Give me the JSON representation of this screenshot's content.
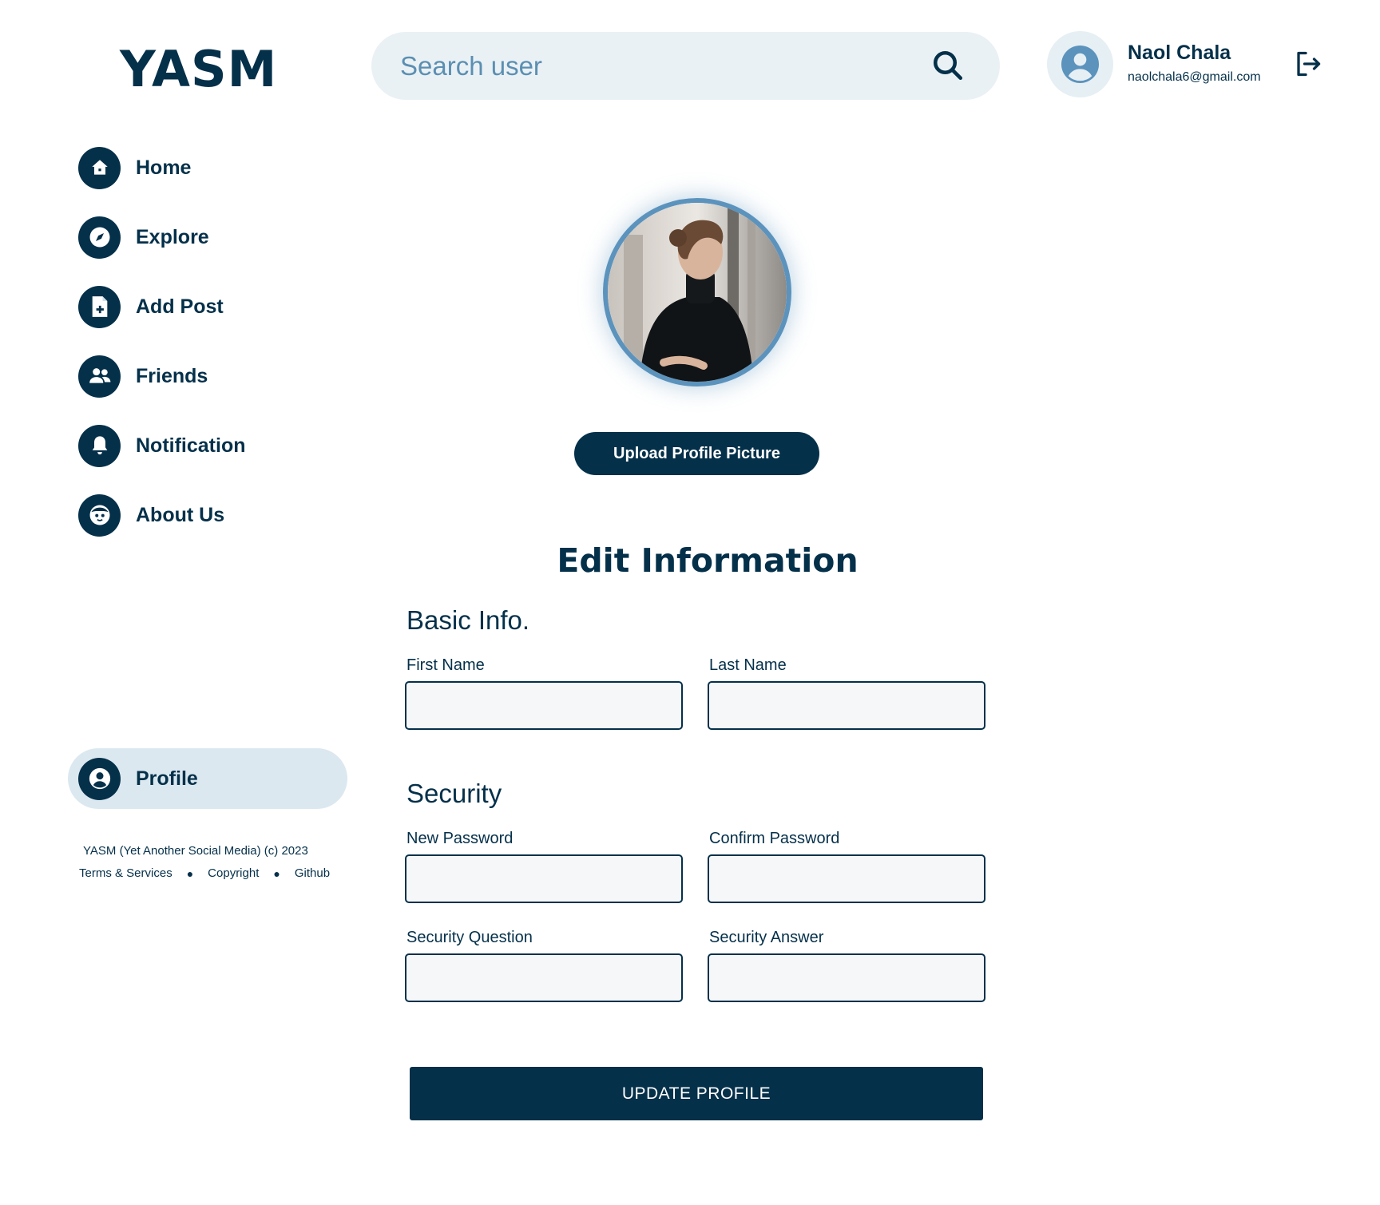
{
  "app": {
    "logo": "YASM"
  },
  "search": {
    "placeholder": "Search user"
  },
  "user": {
    "name": "Naol Chala",
    "email": "naolchala6@gmail.com"
  },
  "nav": {
    "items": [
      {
        "label": "Home",
        "icon": "home-icon"
      },
      {
        "label": "Explore",
        "icon": "compass-icon"
      },
      {
        "label": "Add Post",
        "icon": "add-document-icon"
      },
      {
        "label": "Friends",
        "icon": "users-icon"
      },
      {
        "label": "Notification",
        "icon": "bell-icon"
      },
      {
        "label": "About Us",
        "icon": "face-icon"
      }
    ],
    "profile": {
      "label": "Profile",
      "icon": "user-circle-icon"
    }
  },
  "footer": {
    "line1": "YASM (Yet Another Social Media) (c) 2023",
    "links": [
      "Terms & Services",
      "Copyright",
      "Github"
    ]
  },
  "profile_picture": {
    "upload_label": "Upload Profile Picture"
  },
  "form": {
    "title": "Edit Information",
    "basic": {
      "title": "Basic Info.",
      "first_name_label": "First Name",
      "last_name_label": "Last Name"
    },
    "security": {
      "title": "Security",
      "new_password_label": "New Password",
      "confirm_password_label": "Confirm Password",
      "question_label": "Security Question",
      "answer_label": "Security Answer"
    },
    "submit_label": "UPDATE PROFILE"
  },
  "colors": {
    "primary": "#04304a",
    "accent": "#5b93bd",
    "surface": "#eaf1f5",
    "active_pill": "#dce8f0"
  }
}
